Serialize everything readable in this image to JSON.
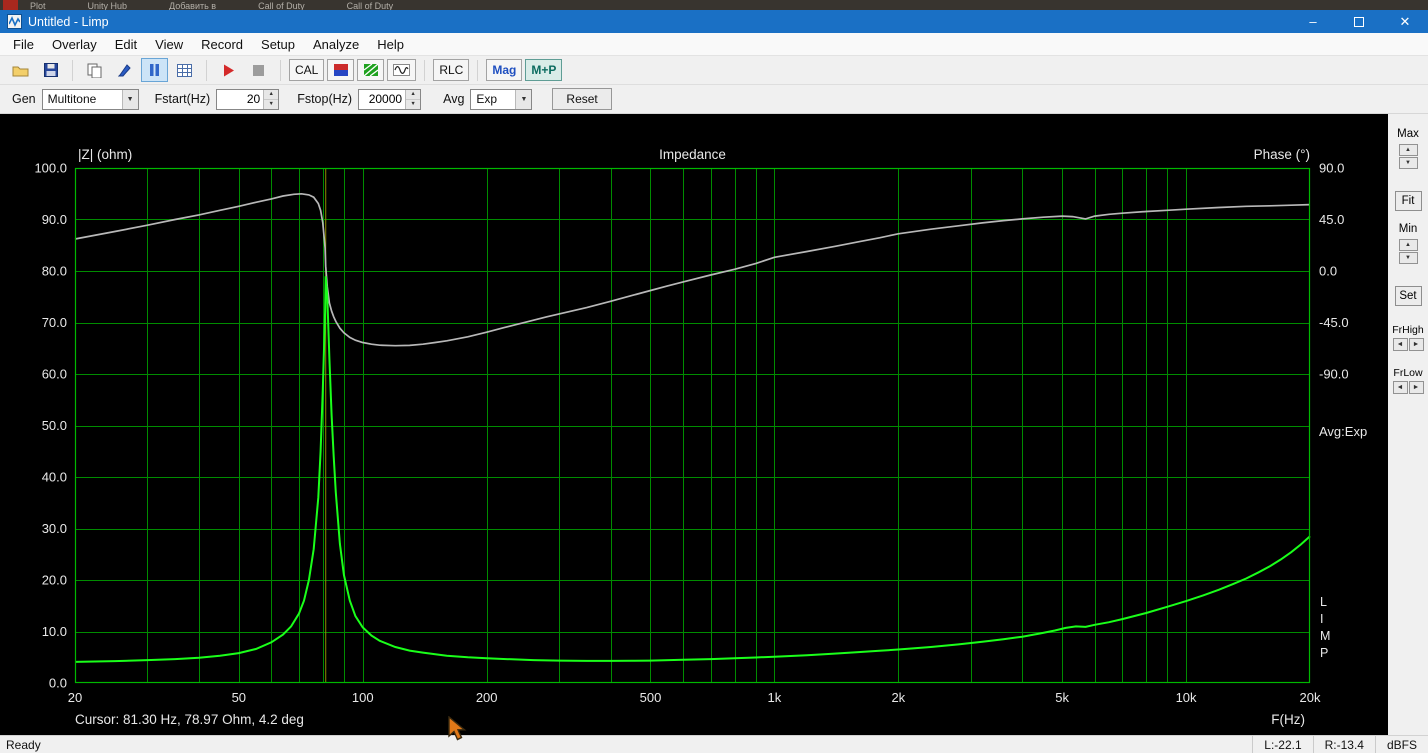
{
  "background_strip": {
    "tabs": [
      "Plot",
      "Unity Hub",
      "Добавить в",
      "Call of Duty",
      "Call of Duty"
    ]
  },
  "window": {
    "title": "Untitled - Limp"
  },
  "menu": {
    "items": [
      "File",
      "Overlay",
      "Edit",
      "View",
      "Record",
      "Setup",
      "Analyze",
      "Help"
    ]
  },
  "toolbar": {
    "cal_label": "CAL",
    "rlc_label": "RLC",
    "mag_label": "Mag",
    "mp_label": "M+P",
    "icons": [
      "open-folder",
      "save",
      "copy",
      "pen",
      "pause",
      "table",
      "record-play",
      "record-stop",
      "calibrate",
      "color-scale",
      "overlay-grid",
      "sine-generator",
      "rlc-measure",
      "magnitude-view",
      "magnitude-phase-view"
    ]
  },
  "controls": {
    "gen_label": "Gen",
    "gen_value": "Multitone",
    "fstart_label": "Fstart(Hz)",
    "fstart_value": "20",
    "fstop_label": "Fstop(Hz)",
    "fstop_value": "20000",
    "avg_label": "Avg",
    "avg_value": "Exp",
    "reset_label": "Reset"
  },
  "side_panel": {
    "max_label": "Max",
    "fit_label": "Fit",
    "min_label": "Min",
    "set_label": "Set",
    "frhigh_label": "FrHigh",
    "frlow_label": "FrLow"
  },
  "status_bar": {
    "ready": "Ready",
    "left_level": "L:-22.1",
    "right_level": "R:-13.4",
    "unit": "dBFS"
  },
  "chart_data": {
    "type": "line",
    "title": "Impedance",
    "left_axis_label": "|Z| (ohm)",
    "right_axis_label": "Phase (°)",
    "x_axis_label": "F(Hz)",
    "x_scale": "log",
    "x_range": [
      20,
      20000
    ],
    "left_ylim": [
      0,
      100
    ],
    "left_ticks": [
      100,
      90,
      80,
      70,
      60,
      50,
      40,
      30,
      20,
      10,
      0
    ],
    "left_tick_labels": [
      "100.0",
      "90.0",
      "80.0",
      "70.0",
      "60.0",
      "50.0",
      "40.0",
      "30.0",
      "20.0",
      "10.0",
      "0.0"
    ],
    "right_ticks": [
      90,
      45,
      0,
      -45,
      -90
    ],
    "right_tick_labels": [
      "90.0",
      "45.0",
      "0.0",
      "-45.0",
      "-90.0"
    ],
    "right_axis_map": {
      "ohm_at_zero_deg": 80,
      "ohm_per_45deg": 10
    },
    "x_tick_values": [
      20,
      50,
      100,
      200,
      500,
      1000,
      2000,
      5000,
      10000,
      20000
    ],
    "x_tick_labels": [
      "20",
      "50",
      "100",
      "200",
      "500",
      "1k",
      "2k",
      "5k",
      "10k",
      "20k"
    ],
    "grid_color": "#008c00",
    "border_color": "#00b800",
    "avg_text": "Avg:Exp",
    "watermark": "LIMP",
    "cursor": {
      "freq_hz": 81.3,
      "impedance_ohm": 78.97,
      "phase_deg": 4.2,
      "readout": "Cursor: 81.30 Hz, 78.97 Ohm, 4.2 deg",
      "color": "#8f8f00"
    },
    "series": [
      {
        "name": "Impedance",
        "unit": "ohm",
        "color": "#1aff1a",
        "points": [
          [
            20,
            4.1
          ],
          [
            25,
            4.25
          ],
          [
            30,
            4.45
          ],
          [
            35,
            4.65
          ],
          [
            40,
            4.9
          ],
          [
            45,
            5.3
          ],
          [
            50,
            5.8
          ],
          [
            55,
            6.6
          ],
          [
            60,
            7.9
          ],
          [
            64,
            9.4
          ],
          [
            67,
            11.0
          ],
          [
            70,
            13.5
          ],
          [
            72,
            16.0
          ],
          [
            74,
            20.0
          ],
          [
            76,
            26.0
          ],
          [
            78,
            36.0
          ],
          [
            79,
            45.0
          ],
          [
            80,
            57.0
          ],
          [
            81,
            72.0
          ],
          [
            81.3,
            78.97
          ],
          [
            82,
            75.0
          ],
          [
            83,
            63.0
          ],
          [
            84,
            52.0
          ],
          [
            85,
            44.0
          ],
          [
            86,
            37.0
          ],
          [
            88,
            27.0
          ],
          [
            90,
            21.0
          ],
          [
            93,
            16.0
          ],
          [
            96,
            13.0
          ],
          [
            100,
            10.8
          ],
          [
            105,
            9.2
          ],
          [
            110,
            8.2
          ],
          [
            120,
            7.0
          ],
          [
            130,
            6.3
          ],
          [
            140,
            5.9
          ],
          [
            160,
            5.3
          ],
          [
            180,
            5.0
          ],
          [
            200,
            4.8
          ],
          [
            230,
            4.6
          ],
          [
            260,
            4.45
          ],
          [
            300,
            4.35
          ],
          [
            350,
            4.3
          ],
          [
            400,
            4.3
          ],
          [
            450,
            4.32
          ],
          [
            500,
            4.35
          ],
          [
            600,
            4.5
          ],
          [
            700,
            4.65
          ],
          [
            800,
            4.8
          ],
          [
            900,
            4.95
          ],
          [
            1000,
            5.1
          ],
          [
            1200,
            5.4
          ],
          [
            1400,
            5.7
          ],
          [
            1600,
            6.0
          ],
          [
            1800,
            6.25
          ],
          [
            2000,
            6.5
          ],
          [
            2400,
            7.0
          ],
          [
            2800,
            7.5
          ],
          [
            3200,
            8.0
          ],
          [
            3600,
            8.5
          ],
          [
            4000,
            9.0
          ],
          [
            4400,
            9.6
          ],
          [
            4800,
            10.2
          ],
          [
            5100,
            10.7
          ],
          [
            5400,
            11.0
          ],
          [
            5700,
            10.9
          ],
          [
            6000,
            11.3
          ],
          [
            6500,
            11.8
          ],
          [
            7000,
            12.4
          ],
          [
            8000,
            13.6
          ],
          [
            9000,
            14.8
          ],
          [
            10000,
            15.9
          ],
          [
            11000,
            17.0
          ],
          [
            12000,
            18.1
          ],
          [
            13000,
            19.2
          ],
          [
            14000,
            20.3
          ],
          [
            15000,
            21.5
          ],
          [
            16000,
            22.7
          ],
          [
            17000,
            24.0
          ],
          [
            18000,
            25.4
          ],
          [
            19000,
            26.9
          ],
          [
            20000,
            28.5
          ]
        ]
      },
      {
        "name": "Phase",
        "unit": "deg",
        "color": "#b8b8b8",
        "points": [
          [
            20,
            28
          ],
          [
            25,
            34.5
          ],
          [
            30,
            40
          ],
          [
            35,
            45
          ],
          [
            40,
            49
          ],
          [
            45,
            53
          ],
          [
            50,
            56.5
          ],
          [
            55,
            60
          ],
          [
            60,
            63
          ],
          [
            64,
            65.5
          ],
          [
            68,
            67
          ],
          [
            71,
            67.5
          ],
          [
            74,
            66.5
          ],
          [
            76,
            64.5
          ],
          [
            78,
            59
          ],
          [
            79,
            53
          ],
          [
            80,
            42
          ],
          [
            81,
            20
          ],
          [
            81.3,
            4.2
          ],
          [
            82,
            -14
          ],
          [
            83,
            -28
          ],
          [
            84,
            -35
          ],
          [
            85,
            -40
          ],
          [
            86,
            -44
          ],
          [
            88,
            -50
          ],
          [
            90,
            -54
          ],
          [
            93,
            -58
          ],
          [
            96,
            -60.5
          ],
          [
            100,
            -62.5
          ],
          [
            105,
            -64
          ],
          [
            110,
            -64.8
          ],
          [
            120,
            -65.3
          ],
          [
            130,
            -65
          ],
          [
            140,
            -64
          ],
          [
            150,
            -62.5
          ],
          [
            160,
            -61
          ],
          [
            180,
            -57.5
          ],
          [
            200,
            -53.5
          ],
          [
            220,
            -49.5
          ],
          [
            250,
            -44.5
          ],
          [
            280,
            -40
          ],
          [
            300,
            -37.5
          ],
          [
            350,
            -32
          ],
          [
            400,
            -26.5
          ],
          [
            450,
            -21.5
          ],
          [
            500,
            -17
          ],
          [
            550,
            -13
          ],
          [
            600,
            -9.5
          ],
          [
            700,
            -3.5
          ],
          [
            800,
            1.5
          ],
          [
            900,
            6.5
          ],
          [
            1000,
            12
          ],
          [
            1200,
            17
          ],
          [
            1400,
            21.5
          ],
          [
            1600,
            25.5
          ],
          [
            1800,
            29
          ],
          [
            2000,
            32.5
          ],
          [
            2400,
            36.5
          ],
          [
            2800,
            39.5
          ],
          [
            3200,
            42
          ],
          [
            3600,
            44
          ],
          [
            4000,
            45.5
          ],
          [
            4500,
            47
          ],
          [
            5000,
            48
          ],
          [
            5300,
            47.5
          ],
          [
            5700,
            45.5
          ],
          [
            6000,
            48
          ],
          [
            6500,
            49.5
          ],
          [
            7000,
            50.5
          ],
          [
            8000,
            52
          ],
          [
            9000,
            53
          ],
          [
            10000,
            54
          ],
          [
            12000,
            55.5
          ],
          [
            14000,
            56.5
          ],
          [
            16000,
            57
          ],
          [
            18000,
            57.5
          ],
          [
            20000,
            58
          ]
        ]
      }
    ]
  }
}
